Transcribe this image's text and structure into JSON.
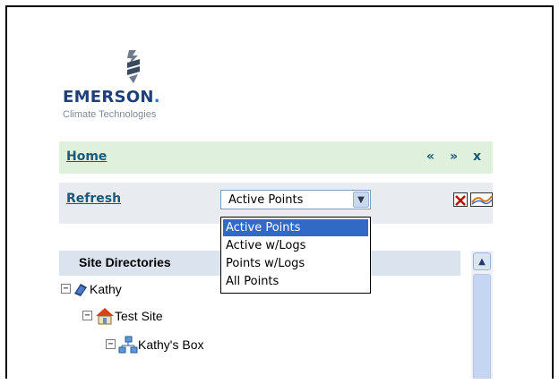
{
  "logo": {
    "brand": "EMERSON",
    "brand_dot": ".",
    "tagline": "Climate Technologies"
  },
  "home": {
    "label": "Home",
    "controls": [
      "«",
      "»",
      "x"
    ]
  },
  "refresh": {
    "label": "Refresh",
    "select_value": "Active Points",
    "options": [
      "Active Points",
      "Active w/Logs",
      "Points w/Logs",
      "All Points"
    ],
    "selected_option": "Active Points"
  },
  "site": {
    "title": "Site Directories"
  },
  "tree": [
    {
      "label": "Kathy",
      "icon": "book-icon"
    },
    {
      "label": "Test Site",
      "icon": "house-icon"
    },
    {
      "label": "Kathy's Box",
      "icon": "network-icon"
    }
  ],
  "colors": {
    "home_bar": "#dff0dc",
    "refresh_bar": "#e8ecf0",
    "link": "#1a5a78",
    "selection": "#3169c6",
    "brand": "#1f3f7a"
  }
}
